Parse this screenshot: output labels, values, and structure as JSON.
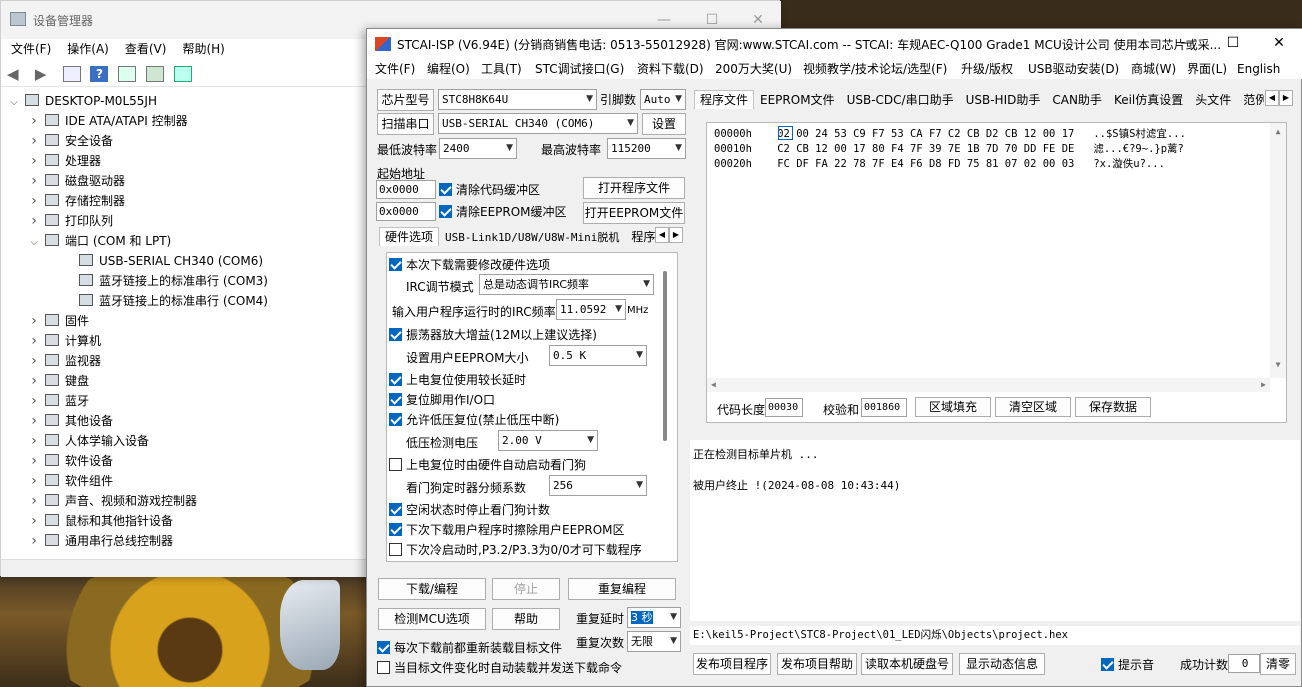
{
  "devmgr": {
    "title": "设备管理器",
    "menu": [
      "文件(F)",
      "操作(A)",
      "查看(V)",
      "帮助(H)"
    ],
    "toolbar_icons": [
      "back-arrow-icon",
      "forward-arrow-icon",
      "properties-icon",
      "help-icon",
      "update-driver-icon",
      "scan-hardware-icon",
      "monitor-icon"
    ],
    "tree": [
      {
        "label": "DESKTOP-M0L55JH",
        "level": 0,
        "expanded": true,
        "icon": "computer-icon"
      },
      {
        "label": "IDE ATA/ATAPI 控制器",
        "level": 1,
        "expanded": false,
        "icon": "ide-icon"
      },
      {
        "label": "安全设备",
        "level": 1,
        "expanded": false,
        "icon": "security-icon"
      },
      {
        "label": "处理器",
        "level": 1,
        "expanded": false,
        "icon": "processor-icon"
      },
      {
        "label": "磁盘驱动器",
        "level": 1,
        "expanded": false,
        "icon": "disk-icon"
      },
      {
        "label": "存储控制器",
        "level": 1,
        "expanded": false,
        "icon": "storage-icon"
      },
      {
        "label": "打印队列",
        "level": 1,
        "expanded": false,
        "icon": "printer-icon"
      },
      {
        "label": "端口 (COM 和 LPT)",
        "level": 1,
        "expanded": true,
        "icon": "port-icon"
      },
      {
        "label": "USB-SERIAL CH340 (COM6)",
        "level": 2,
        "expanded": null,
        "icon": "port-icon"
      },
      {
        "label": "蓝牙链接上的标准串行 (COM3)",
        "level": 2,
        "expanded": null,
        "icon": "port-icon"
      },
      {
        "label": "蓝牙链接上的标准串行 (COM4)",
        "level": 2,
        "expanded": null,
        "icon": "port-icon"
      },
      {
        "label": "固件",
        "level": 1,
        "expanded": false,
        "icon": "firmware-icon"
      },
      {
        "label": "计算机",
        "level": 1,
        "expanded": false,
        "icon": "computer-icon"
      },
      {
        "label": "监视器",
        "level": 1,
        "expanded": false,
        "icon": "monitor-icon"
      },
      {
        "label": "键盘",
        "level": 1,
        "expanded": false,
        "icon": "keyboard-icon"
      },
      {
        "label": "蓝牙",
        "level": 1,
        "expanded": false,
        "icon": "bluetooth-icon"
      },
      {
        "label": "其他设备",
        "level": 1,
        "expanded": false,
        "icon": "other-device-icon"
      },
      {
        "label": "人体学输入设备",
        "level": 1,
        "expanded": false,
        "icon": "hid-icon"
      },
      {
        "label": "软件设备",
        "level": 1,
        "expanded": false,
        "icon": "software-device-icon"
      },
      {
        "label": "软件组件",
        "level": 1,
        "expanded": false,
        "icon": "software-component-icon"
      },
      {
        "label": "声音、视频和游戏控制器",
        "level": 1,
        "expanded": false,
        "icon": "sound-icon"
      },
      {
        "label": "鼠标和其他指针设备",
        "level": 1,
        "expanded": false,
        "icon": "mouse-icon"
      },
      {
        "label": "通用串行总线控制器",
        "level": 1,
        "expanded": false,
        "icon": "usb-icon"
      }
    ]
  },
  "stc": {
    "title": "STCAI-ISP (V6.94E) (分销商销售电话: 0513-55012928) 官网:www.STCAI.com  -- STCAI: 车规AEC-Q100 Grade1 MCU设计公司 使用本司芯片或采...",
    "menu": [
      "文件(F)",
      "编程(O)",
      "工具(T)",
      "STC调试接口(G)",
      "资料下载(D)",
      "200万大奖(U)",
      "视频教学/技术论坛/选型(F)",
      "升级/版权",
      "USB驱动安装(D)",
      "商城(W)",
      "界面(L)",
      "English"
    ],
    "chip_btn": "芯片型号",
    "chip_value": "STC8H8K64U",
    "pin_label": "引脚数",
    "pin_value": "Auto",
    "scan_btn": "扫描串口",
    "port_value": "USB-SERIAL CH340 (COM6)",
    "settings_btn": "设置",
    "min_baud_label": "最低波特率",
    "min_baud": "2400",
    "max_baud_label": "最高波特率",
    "max_baud": "115200",
    "start_addr_label": "起始地址",
    "addr1": "0x0000",
    "clear_code": "清除代码缓冲区",
    "open_prog": "打开程序文件",
    "addr2": "0x0000",
    "clear_eeprom": "清除EEPROM缓冲区",
    "open_eeprom": "打开EEPROM文件",
    "left_tabs": [
      "硬件选项",
      "USB-Link1D/U8W/U8W-Mini脱机",
      "程序加"
    ],
    "hw_options": {
      "opt1": "本次下载需要修改硬件选项",
      "irc_mode_label": "IRC调节模式",
      "irc_mode": "总是动态调节IRC频率",
      "irc_freq_label": "输入用户程序运行时的IRC频率",
      "irc_freq": "11.0592",
      "irc_unit": "MHz",
      "opt2": "振荡器放大增益(12M以上建议选择)",
      "eeprom_label": "设置用户EEPROM大小",
      "eeprom_size": "0.5 K",
      "opt3": "上电复位使用较长延时",
      "opt4": "复位脚用作I/O口",
      "opt5": "允许低压复位(禁止低压中断)",
      "lvd_label": "低压检测电压",
      "lvd_value": "2.00 V",
      "opt6": "上电复位时由硬件自动启动看门狗",
      "wdt_label": "看门狗定时器分频系数",
      "wdt_value": "256",
      "opt7": "空闲状态时停止看门狗计数",
      "opt8": "下次下载用户程序时擦除用户EEPROM区",
      "opt9": "下次冷启动时,P3.2/P3.3为0/0才可下载程序"
    },
    "download_btn": "下载/编程",
    "stop_btn": "停止",
    "reprogram_btn": "重复编程",
    "detect_btn": "检测MCU选项",
    "help_btn": "帮助",
    "repeat_delay_label": "重复延时",
    "repeat_delay": "3 秒",
    "repeat_count_label": "重复次数",
    "repeat_count": "无限",
    "reload_each": "每次下载前都重新装载目标文件",
    "auto_reload": "当目标文件变化时自动装载并发送下载命令",
    "right_tabs": [
      "程序文件",
      "EEPROM文件",
      "USB-CDC/串口助手",
      "USB-HID助手",
      "CAN助手",
      "Keil仿真设置",
      "头文件",
      "范例程序"
    ],
    "hex_rows": [
      {
        "addr": "00000h",
        "bytes": "02 00 24 53 C9 F7 53 CA F7 C2 CB D2 CB 12 00 17",
        "ascii": "..$S镇S村滤宜..."
      },
      {
        "addr": "00010h",
        "bytes": "C2 CB 12 00 17 80 F4 7F 39 7E 1B 7D 70 DD FE DE",
        "ascii": "滤...€?9~.}p蓠?"
      },
      {
        "addr": "00020h",
        "bytes": "FC DF FA 22 78 7F E4 F6 D8 FD 75 81 07 02 00 03",
        "ascii": "?x.漩佚u?..."
      }
    ],
    "code_len_label": "代码长度",
    "code_len": "00030",
    "checksum_label": "校验和",
    "checksum": "001860",
    "fill_btn": "区域填充",
    "clear_btn": "清空区域",
    "save_btn": "保存数据",
    "log": [
      "正在检测目标单片机 ...",
      "",
      "被用户终止 !(2024-08-08 10:43:44)"
    ],
    "path": "E:\\keil5-Project\\STC8-Project\\01_LED闪烁\\Objects\\project.hex",
    "publish_prog": "发布项目程序",
    "publish_help": "发布项目帮助",
    "read_disk": "读取本机硬盘号",
    "show_dynamic": "显示动态信息",
    "sound_label": "提示音",
    "success_label": "成功计数",
    "success_count": "0",
    "clear_count": "清零"
  }
}
